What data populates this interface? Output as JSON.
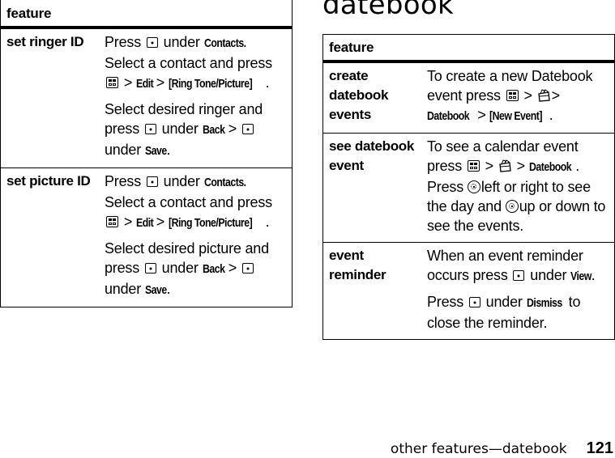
{
  "section_title": "datebook",
  "footer": {
    "running_head": "other features—datebook",
    "page_number": "121"
  },
  "left_table": {
    "header": "feature",
    "rows": [
      {
        "feature": "set ringer ID",
        "p1": {
          "press": "Press",
          "under": "under",
          "contacts": "Contacts.",
          "select": "Select a contact and press",
          "gt1": ">",
          "edit": "Edit",
          "gt2": ">",
          "ring": "[Ring Tone/Picture]",
          "dot": "."
        },
        "p2": {
          "select": "Select desired ringer and",
          "press": "press",
          "under1": "under",
          "back": "Back",
          "gt": ">",
          "under2": "under",
          "save": "Save",
          "dot": "."
        }
      },
      {
        "feature": "set picture ID",
        "p1": {
          "press": "Press",
          "under": "under",
          "contacts": "Contacts.",
          "select": "Select a contact and press",
          "gt1": ">",
          "edit": "Edit",
          "gt2": ">",
          "ring": "[Ring Tone/Picture]",
          "dot": "."
        },
        "p2": {
          "select": "Select desired picture and",
          "press": "press",
          "under1": "under",
          "back": "Back",
          "gt": ">",
          "under2": "under",
          "save": "Save",
          "dot": "."
        }
      }
    ]
  },
  "right_table": {
    "header": "feature",
    "rows": [
      {
        "feature": "create datebook events",
        "p1": {
          "t1": "To create a new Datebook event press",
          "gt1": ">",
          "gt2": ">",
          "datebook": "Datebook",
          "gt3": ">",
          "new_event": "[New Event]",
          "dot": "."
        }
      },
      {
        "feature": "see datebook event",
        "p1": {
          "t1": "To see a calendar event press",
          "gt1": ">",
          "gt2": ">",
          "datebook": "Datebook",
          "dot": ".",
          "press": "Press",
          "t2": "left or right to see the day and",
          "t3": "up or down to see the events."
        }
      },
      {
        "feature": "event reminder",
        "p1": {
          "t1": "When an event reminder occurs press",
          "under": "under",
          "view": "View",
          "dot": "."
        },
        "p2": {
          "press": "Press",
          "under": "under",
          "dismiss": "Dismiss",
          "t2": "to close the reminder."
        }
      }
    ]
  },
  "icons": {
    "soft_key": "soft-key-icon",
    "menu_key": "menu-key-icon",
    "office_tools": "office-tools-icon",
    "nav_key": "nav-key-icon"
  }
}
